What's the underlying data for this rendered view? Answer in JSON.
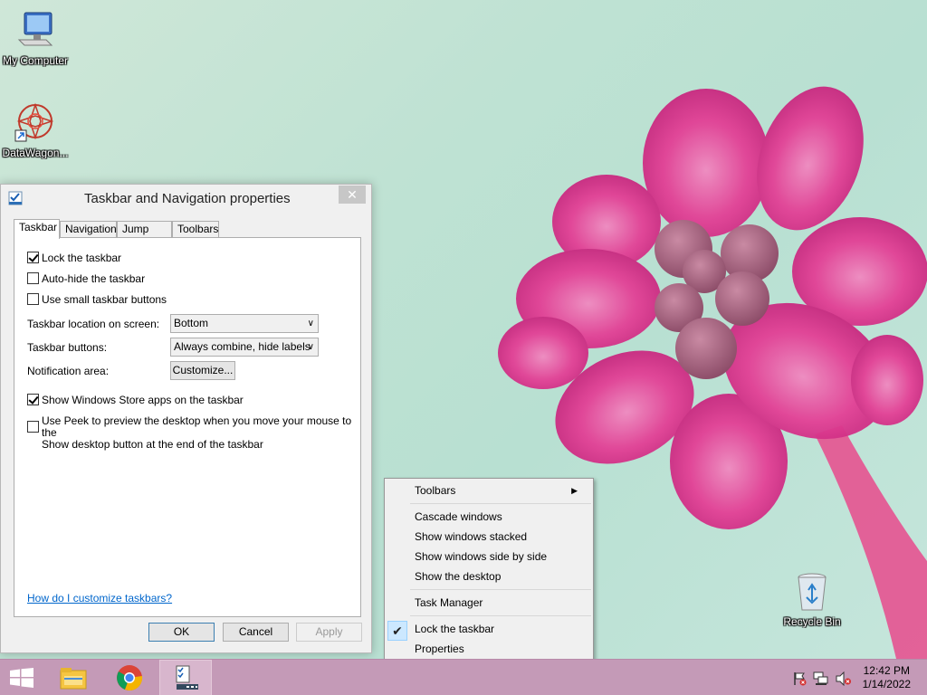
{
  "desktop": {
    "icons": [
      {
        "label": "My Computer",
        "icon": "computer-icon"
      },
      {
        "label": "DataWagon...",
        "icon": "datawagon-icon"
      },
      {
        "label": "Recycle Bin",
        "icon": "recycle-bin-icon"
      }
    ]
  },
  "dialog": {
    "title": "Taskbar and Navigation properties",
    "close_label": "✕",
    "tabs": [
      {
        "label": "Taskbar",
        "active": true
      },
      {
        "label": "Navigation",
        "active": false
      },
      {
        "label": "Jump Lists",
        "active": false
      },
      {
        "label": "Toolbars",
        "active": false
      }
    ],
    "options": {
      "lock_taskbar": {
        "label": "Lock the taskbar",
        "checked": true
      },
      "auto_hide": {
        "label": "Auto-hide the taskbar",
        "checked": false
      },
      "small_buttons": {
        "label": "Use small taskbar buttons",
        "checked": false
      },
      "store_apps": {
        "label": "Show Windows Store apps on the taskbar",
        "checked": true
      },
      "peek_line1": "Use Peek to preview the desktop when you move your mouse to the",
      "peek_line2": "Show desktop button at the end of the taskbar",
      "peek_checked": false
    },
    "location_label": "Taskbar location on screen:",
    "location_value": "Bottom",
    "buttons_label": "Taskbar buttons:",
    "buttons_value": "Always combine, hide labels",
    "notification_label": "Notification area:",
    "customize_label": "Customize...",
    "help_link": "How do I customize taskbars?",
    "ok_label": "OK",
    "cancel_label": "Cancel",
    "apply_label": "Apply"
  },
  "context_menu": {
    "toolbars": "Toolbars",
    "cascade": "Cascade windows",
    "stacked": "Show windows stacked",
    "side_by_side": "Show windows side by side",
    "show_desktop": "Show the desktop",
    "task_manager": "Task Manager",
    "lock_taskbar": "Lock the taskbar",
    "lock_checked": true,
    "properties": "Properties"
  },
  "taskbar": {
    "pinned": [
      "start-icon",
      "file-explorer-icon",
      "chrome-icon",
      "taskbar-properties-icon"
    ],
    "tray_icons": [
      "action-center-flag-icon",
      "network-icon",
      "volume-muted-icon"
    ],
    "time": "12:42 PM",
    "date": "1/14/2022"
  }
}
